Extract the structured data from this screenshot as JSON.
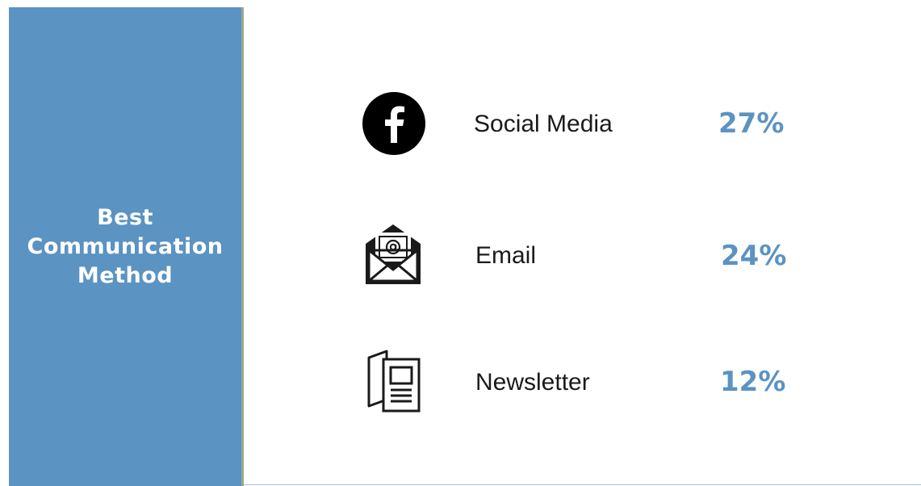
{
  "panel": {
    "title_lines": [
      "Best",
      "Communication",
      "Method"
    ],
    "background": "#5b93c2"
  },
  "accent_color": "#5b93c2",
  "items": [
    {
      "label": "Social Media",
      "value": "27%",
      "icon": "facebook-icon"
    },
    {
      "label": "Email",
      "value": "24%",
      "icon": "envelope-at-icon"
    },
    {
      "label": "Newsletter",
      "value": "12%",
      "icon": "newsletter-icon"
    }
  ]
}
